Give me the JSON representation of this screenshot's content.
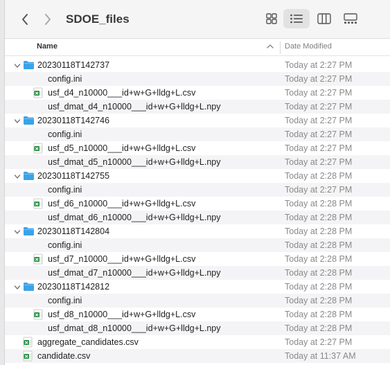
{
  "window": {
    "title": "SDOE_files"
  },
  "toolbar": {
    "back_icon": "chevron-left-icon",
    "forward_icon": "chevron-right-icon",
    "views": [
      "icon-view",
      "list-view",
      "column-view",
      "gallery-view"
    ],
    "active_view": "list-view"
  },
  "columns": {
    "name": "Name",
    "date_modified": "Date Modified"
  },
  "colors": {
    "folder": "#3ba3e9",
    "csv_icon": "#1f8f3e",
    "selected_view": "#e2e2e2",
    "alt_row": "#f4f4f6"
  },
  "rows": [
    {
      "type": "folder",
      "level": 0,
      "name": "20230118T142737",
      "date": "Today at 2:27 PM"
    },
    {
      "type": "file",
      "level": 1,
      "name": "config.ini",
      "date": "Today at 2:27 PM"
    },
    {
      "type": "csv",
      "level": 1,
      "name": "usf_d4_n10000___id+w+G+lldg+L.csv",
      "date": "Today at 2:27 PM"
    },
    {
      "type": "file",
      "level": 1,
      "name": "usf_dmat_d4_n10000___id+w+G+lldg+L.npy",
      "date": "Today at 2:27 PM"
    },
    {
      "type": "folder",
      "level": 0,
      "name": "20230118T142746",
      "date": "Today at 2:27 PM"
    },
    {
      "type": "file",
      "level": 1,
      "name": "config.ini",
      "date": "Today at 2:27 PM"
    },
    {
      "type": "csv",
      "level": 1,
      "name": "usf_d5_n10000___id+w+G+lldg+L.csv",
      "date": "Today at 2:27 PM"
    },
    {
      "type": "file",
      "level": 1,
      "name": "usf_dmat_d5_n10000___id+w+G+lldg+L.npy",
      "date": "Today at 2:27 PM"
    },
    {
      "type": "folder",
      "level": 0,
      "name": "20230118T142755",
      "date": "Today at 2:28 PM"
    },
    {
      "type": "file",
      "level": 1,
      "name": "config.ini",
      "date": "Today at 2:27 PM"
    },
    {
      "type": "csv",
      "level": 1,
      "name": "usf_d6_n10000___id+w+G+lldg+L.csv",
      "date": "Today at 2:28 PM"
    },
    {
      "type": "file",
      "level": 1,
      "name": "usf_dmat_d6_n10000___id+w+G+lldg+L.npy",
      "date": "Today at 2:28 PM"
    },
    {
      "type": "folder",
      "level": 0,
      "name": "20230118T142804",
      "date": "Today at 2:28 PM"
    },
    {
      "type": "file",
      "level": 1,
      "name": "config.ini",
      "date": "Today at 2:28 PM"
    },
    {
      "type": "csv",
      "level": 1,
      "name": "usf_d7_n10000___id+w+G+lldg+L.csv",
      "date": "Today at 2:28 PM"
    },
    {
      "type": "file",
      "level": 1,
      "name": "usf_dmat_d7_n10000___id+w+G+lldg+L.npy",
      "date": "Today at 2:28 PM"
    },
    {
      "type": "folder",
      "level": 0,
      "name": "20230118T142812",
      "date": "Today at 2:28 PM"
    },
    {
      "type": "file",
      "level": 1,
      "name": "config.ini",
      "date": "Today at 2:28 PM"
    },
    {
      "type": "csv",
      "level": 1,
      "name": "usf_d8_n10000___id+w+G+lldg+L.csv",
      "date": "Today at 2:28 PM"
    },
    {
      "type": "file",
      "level": 1,
      "name": "usf_dmat_d8_n10000___id+w+G+lldg+L.npy",
      "date": "Today at 2:28 PM"
    },
    {
      "type": "csv",
      "level": 0,
      "root": true,
      "name": "aggregate_candidates.csv",
      "date": "Today at 2:27 PM"
    },
    {
      "type": "csv",
      "level": 0,
      "root": true,
      "name": "candidate.csv",
      "date": "Today at 11:37 AM"
    }
  ]
}
